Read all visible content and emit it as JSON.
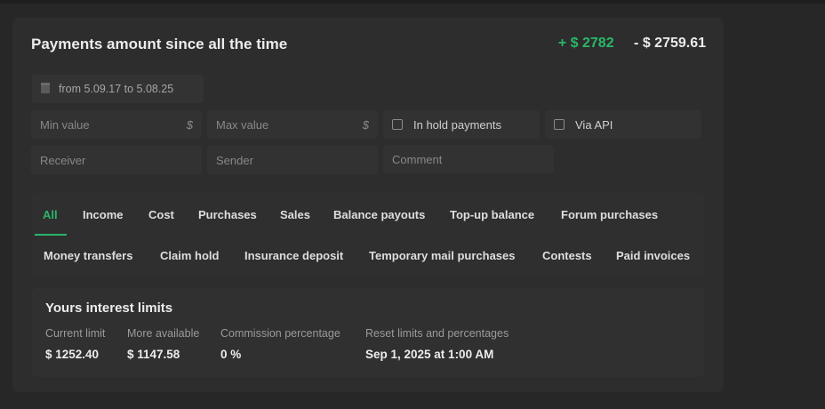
{
  "header": {
    "title": "Payments amount since all the time",
    "income_total": "+ $ 2782",
    "cost_total": "- $ 2759.61"
  },
  "filters": {
    "date_range": "from 5.09.17 to 5.08.25",
    "min_value_placeholder": "Min value",
    "max_value_placeholder": "Max value",
    "currency_symbol": "$",
    "in_hold_label": "In hold payments",
    "via_api_label": "Via API",
    "receiver_placeholder": "Receiver",
    "sender_placeholder": "Sender",
    "comment_placeholder": "Comment"
  },
  "tabs": {
    "row1": [
      "All",
      "Income",
      "Cost",
      "Purchases",
      "Sales",
      "Balance payouts",
      "Top-up balance",
      "Forum purchases"
    ],
    "row2": [
      "Money transfers",
      "Claim hold",
      "Insurance deposit",
      "Temporary mail purchases",
      "Contests",
      "Paid invoices"
    ],
    "active": "All"
  },
  "limits": {
    "title": "Yours interest limits",
    "current_limit_label": "Current limit",
    "current_limit_value": "$ 1252.40",
    "more_available_label": "More available",
    "more_available_value": "$ 1147.58",
    "commission_label": "Commission percentage",
    "commission_value": "0 %",
    "reset_label": "Reset limits and percentages",
    "reset_value": "Sep 1, 2025 at 1:00 AM"
  },
  "colors": {
    "accent_green": "#2bb46a",
    "panel": "#2d2d2d",
    "background": "#272727"
  }
}
